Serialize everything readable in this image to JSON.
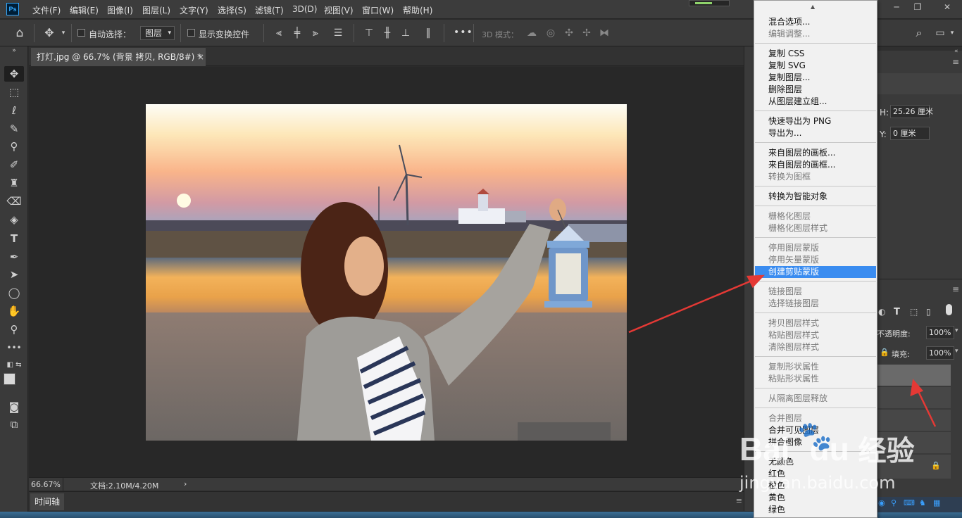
{
  "app": {
    "logo": "Ps"
  },
  "menubar": {
    "items": [
      "文件(F)",
      "编辑(E)",
      "图像(I)",
      "图层(L)",
      "文字(Y)",
      "选择(S)",
      "滤镜(T)",
      "3D(D)",
      "视图(V)",
      "窗口(W)",
      "帮助(H)"
    ]
  },
  "window_controls": {
    "minimize": "─",
    "restore": "❐",
    "close": "✕"
  },
  "options_bar": {
    "auto_select_label": "自动选择：",
    "auto_select_value": "图层",
    "show_transform_label": "显示变换控件",
    "more_label": "•••",
    "mode_3d_label": "3D 模式："
  },
  "document": {
    "tab_title": "打灯.jpg @ 66.7% (背景 拷贝, RGB/8#) *",
    "close": "×"
  },
  "status": {
    "zoom": "66.67%",
    "doc_size": "文档:2.10M/4.20M",
    "arrow": "›"
  },
  "timeline": {
    "label": "时间轴"
  },
  "properties": {
    "w_label": "H:",
    "w_value": "25.26 厘米",
    "y_label": "Y:",
    "y_value": "0 厘米"
  },
  "layers_panel": {
    "opacity_label": "不透明度:",
    "opacity_value": "100%",
    "fill_label": "填充:",
    "fill_value": "100%"
  },
  "context_menu": {
    "items": [
      {
        "label": "混合选项...",
        "disabled": false
      },
      {
        "label": "编辑调整...",
        "disabled": true
      },
      {
        "label": "复制 CSS",
        "disabled": false
      },
      {
        "label": "复制 SVG",
        "disabled": false
      },
      {
        "label": "复制图层...",
        "disabled": false
      },
      {
        "label": "删除图层",
        "disabled": false
      },
      {
        "label": "从图层建立组...",
        "disabled": false
      },
      {
        "label": "快速导出为 PNG",
        "disabled": false
      },
      {
        "label": "导出为...",
        "disabled": false
      },
      {
        "label": "来自图层的画板...",
        "disabled": false
      },
      {
        "label": "来自图层的画框...",
        "disabled": false
      },
      {
        "label": "转换为图框",
        "disabled": true
      },
      {
        "label": "转换为智能对象",
        "disabled": false
      },
      {
        "label": "栅格化图层",
        "disabled": true
      },
      {
        "label": "栅格化图层样式",
        "disabled": true
      },
      {
        "label": "停用图层蒙版",
        "disabled": true
      },
      {
        "label": "停用矢量蒙版",
        "disabled": true
      },
      {
        "label": "创建剪贴蒙版",
        "disabled": false,
        "highlighted": true
      },
      {
        "label": "链接图层",
        "disabled": true
      },
      {
        "label": "选择链接图层",
        "disabled": true
      },
      {
        "label": "拷贝图层样式",
        "disabled": true
      },
      {
        "label": "粘贴图层样式",
        "disabled": true
      },
      {
        "label": "清除图层样式",
        "disabled": true
      },
      {
        "label": "复制形状属性",
        "disabled": true
      },
      {
        "label": "粘贴形状属性",
        "disabled": true
      },
      {
        "label": "从隔离图层释放",
        "disabled": true
      },
      {
        "label": "合并图层",
        "disabled": true
      },
      {
        "label": "合并可见图层",
        "disabled": false
      },
      {
        "label": "拼合图像",
        "disabled": false
      },
      {
        "label": "无颜色",
        "disabled": false
      },
      {
        "label": "红色",
        "disabled": false
      },
      {
        "label": "橙色",
        "disabled": false
      },
      {
        "label": "黄色",
        "disabled": false
      },
      {
        "label": "绿色",
        "disabled": false
      }
    ]
  },
  "watermark": {
    "brand": "Bai",
    "brand2": "du",
    "jingyan": "经验",
    "url": "jingyan.baidu.com"
  },
  "colors": {
    "highlight": "#3a8cf0",
    "arrow": "#e53935",
    "app_bg": "#2b2b2b"
  }
}
